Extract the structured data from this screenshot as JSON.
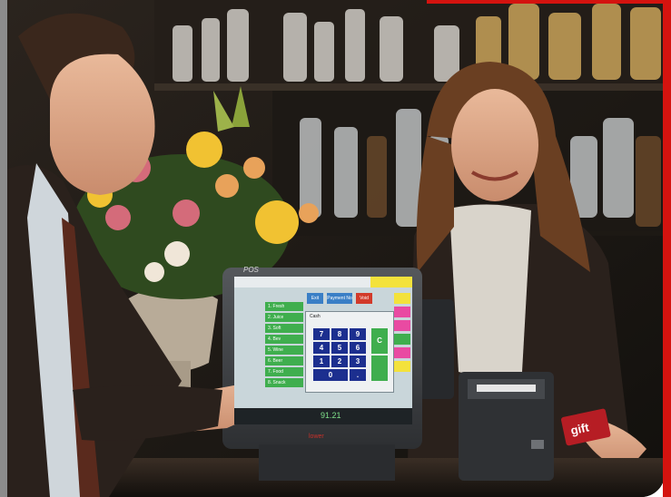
{
  "scene": {
    "description_free": true,
    "palette": {
      "frame_red": "#d4130f",
      "bar_background": "#1e1a16",
      "suit": "#2a211c",
      "sweater": "#d9d4cb",
      "monitor": "#3e4043",
      "pos_blue": "#1c2f8f",
      "pos_green": "#3fae4e",
      "flower_yellow": "#f1c232"
    }
  },
  "monitor": {
    "brand": "POS",
    "badge_text": "lower",
    "footer_readout": "91.21",
    "screen": {
      "header_buttons": [
        "Exit",
        "Payment No",
        "Void"
      ],
      "dialog_title": "Cash",
      "keypad_digits": [
        "7",
        "8",
        "9",
        "4",
        "5",
        "6",
        "1",
        "2",
        "3",
        "0",
        "."
      ],
      "keypad_clear": "C",
      "menu_items": [
        "1. Fresh",
        "2. Juice",
        "3. Soft",
        "4. Bev",
        "5. Wine",
        "6. Beer",
        "7. Food",
        "8. Snack"
      ]
    }
  },
  "card": {
    "text": "gift"
  }
}
